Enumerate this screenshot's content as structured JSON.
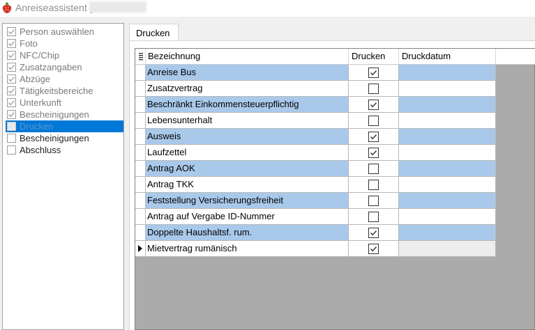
{
  "window": {
    "title": "Anreiseassistent ["
  },
  "steps": [
    {
      "label": "Person auswählen",
      "checked": true,
      "state": "done"
    },
    {
      "label": "Foto",
      "checked": true,
      "state": "done"
    },
    {
      "label": "NFC/Chip",
      "checked": true,
      "state": "done"
    },
    {
      "label": "Zusatzangaben",
      "checked": true,
      "state": "done"
    },
    {
      "label": "Abzüge",
      "checked": true,
      "state": "done"
    },
    {
      "label": "Tätigkeitsbereiche",
      "checked": true,
      "state": "done"
    },
    {
      "label": "Unterkunft",
      "checked": true,
      "state": "done"
    },
    {
      "label": "Bescheinigungen",
      "checked": true,
      "state": "done"
    },
    {
      "label": "Drucken",
      "checked": false,
      "state": "current"
    },
    {
      "label": "Bescheinigungen",
      "checked": false,
      "state": "future"
    },
    {
      "label": "Abschluss",
      "checked": false,
      "state": "future"
    }
  ],
  "tab": {
    "label": "Drucken"
  },
  "grid": {
    "columns": {
      "name": "Bezeichnung",
      "print": "Drucken",
      "date": "Druckdatum"
    },
    "rows": [
      {
        "name": "Anreise Bus",
        "print": true,
        "date": "",
        "highlight": true
      },
      {
        "name": "Zusatzvertrag",
        "print": false,
        "date": "",
        "highlight": false
      },
      {
        "name": "Beschränkt Einkommensteuerpflichtig",
        "print": true,
        "date": "",
        "highlight": true
      },
      {
        "name": "Lebensunterhalt",
        "print": false,
        "date": "",
        "highlight": false
      },
      {
        "name": "Ausweis",
        "print": true,
        "date": "",
        "highlight": true
      },
      {
        "name": "Laufzettel",
        "print": true,
        "date": "",
        "highlight": false
      },
      {
        "name": "Antrag AOK",
        "print": false,
        "date": "",
        "highlight": true
      },
      {
        "name": "Antrag TKK",
        "print": false,
        "date": "",
        "highlight": false
      },
      {
        "name": "Feststellung Versicherungsfreiheit",
        "print": false,
        "date": "",
        "highlight": true
      },
      {
        "name": "Antrag auf Vergabe ID-Nummer",
        "print": false,
        "date": "",
        "highlight": false
      },
      {
        "name": "Doppelte Haushaltsf. rum.",
        "print": true,
        "date": "",
        "highlight": true
      },
      {
        "name": "Mietvertrag rumänisch",
        "print": true,
        "date": "",
        "highlight": false,
        "current": true
      }
    ]
  },
  "colors": {
    "selection": "#0078d7",
    "row_highlight": "#a9c9eb",
    "grid_background": "#ababab"
  },
  "icons": {
    "app": "strawberry-icon",
    "column_chooser": "column-chooser-icon",
    "row_pointer": "row-pointer-icon"
  }
}
